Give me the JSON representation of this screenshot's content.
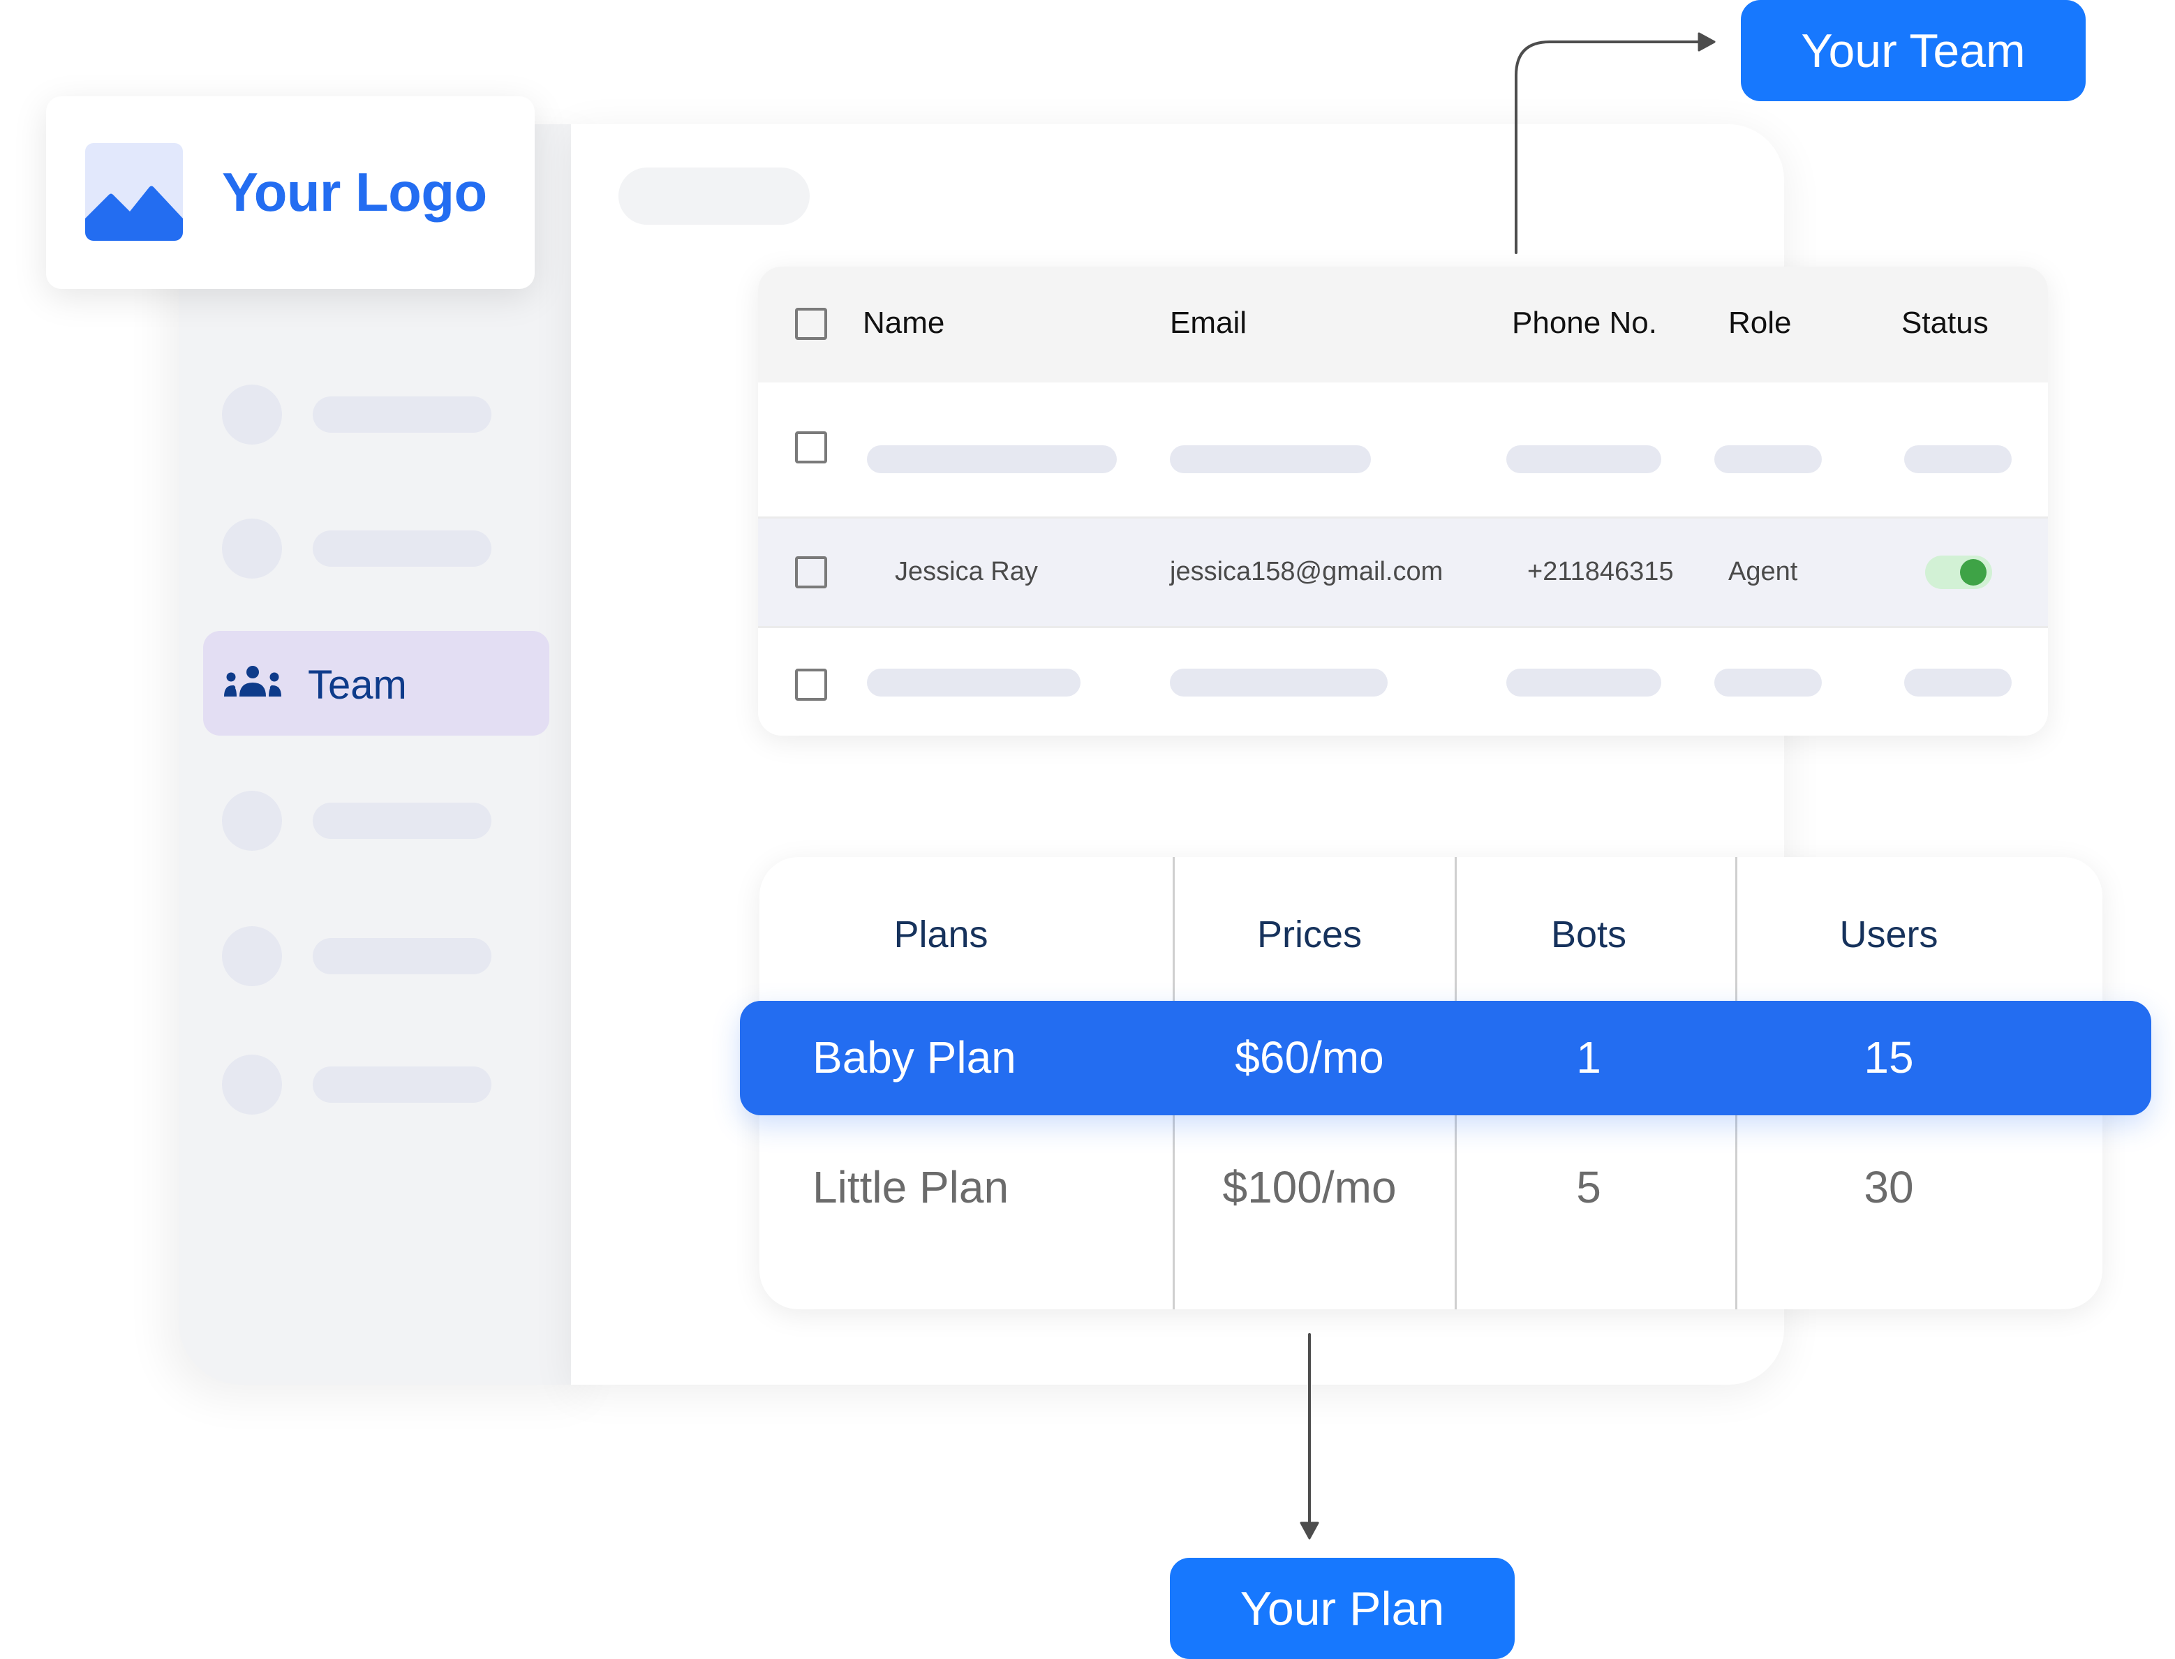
{
  "logo": {
    "text": "Your Logo",
    "icon": "image-placeholder-icon"
  },
  "sidebar": {
    "active_item": {
      "label": "Team",
      "icon": "team-icon"
    },
    "placeholder_count": 5
  },
  "team_table": {
    "headers": [
      "Name",
      "Email",
      "Phone No.",
      "Role",
      "Status"
    ],
    "rows": [
      {
        "placeholder": true
      },
      {
        "name": "Jessica Ray",
        "email": "jessica158@gmail.com",
        "phone": "+211846315",
        "role": "Agent",
        "status": "active",
        "status_toggle_on": true
      },
      {
        "placeholder": true
      }
    ]
  },
  "plans_table": {
    "headers": [
      "Plans",
      "Prices",
      "Bots",
      "Users"
    ],
    "rows": [
      {
        "plan": "Baby Plan",
        "price": "$60/mo",
        "bots": "1",
        "users": "15",
        "highlighted": true
      },
      {
        "plan": "Little Plan",
        "price": "$100/mo",
        "bots": "5",
        "users": "30",
        "highlighted": false
      }
    ]
  },
  "callouts": {
    "team": "Your Team",
    "plan": "Your Plan"
  },
  "colors": {
    "brand_blue": "#236df1",
    "callout_blue": "#1778fe",
    "toggle_on": "#3ea346",
    "active_nav_bg": "#e3def3",
    "active_nav_text": "#0e3b8a"
  }
}
